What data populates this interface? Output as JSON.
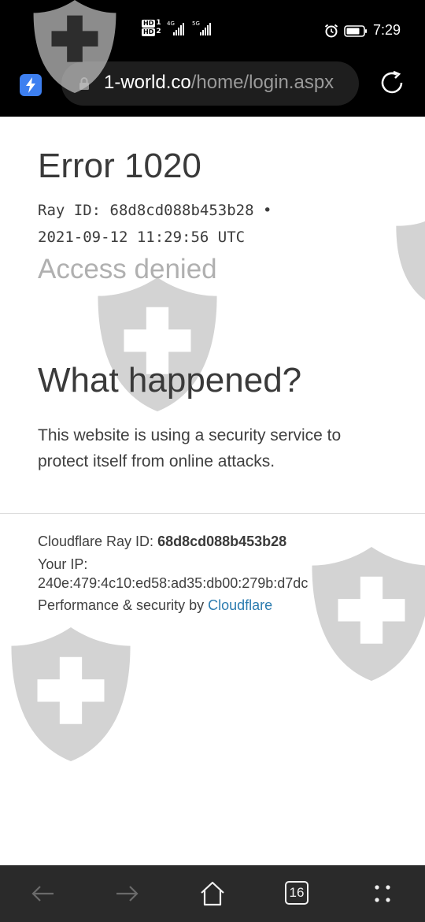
{
  "status_bar": {
    "sim1_tag": "HD",
    "sim1_num": "1",
    "sim2_tag": "HD",
    "sim2_num": "2",
    "net1": "4G",
    "net2": "5G",
    "time": "7:29",
    "icons": [
      "alarm-icon",
      "battery-icon",
      "signal-icon"
    ]
  },
  "browser": {
    "url_host": "1-world.co",
    "url_path": "/home/login.aspx",
    "icons": [
      "bolt-icon",
      "lock-icon",
      "reload-icon"
    ]
  },
  "error": {
    "title": "Error 1020",
    "ray_line": "Ray ID: 68d8cd088b453b28 •",
    "timestamp": "2021-09-12 11:29:56 UTC",
    "subtitle": "Access denied"
  },
  "explanation": {
    "heading": "What happened?",
    "body": "This website is using a security service to protect itself from online attacks."
  },
  "footer": {
    "ray_label": "Cloudflare Ray ID: ",
    "ray_value": "68d8cd088b453b28",
    "ip_label": "Your IP:",
    "ip_value": "240e:479:4c10:ed58:ad35:db00:279b:d7dc",
    "perf_text": "Performance & security by ",
    "cf_link": "Cloudflare"
  },
  "bottom_nav": {
    "tab_count": "16",
    "icons": [
      "back-icon",
      "forward-icon",
      "home-icon",
      "tabs-icon",
      "more-icon"
    ]
  },
  "colors": {
    "link": "#2c7cb0",
    "accent_button": "#3d7ff0",
    "watermark": "#c8c8c8"
  }
}
